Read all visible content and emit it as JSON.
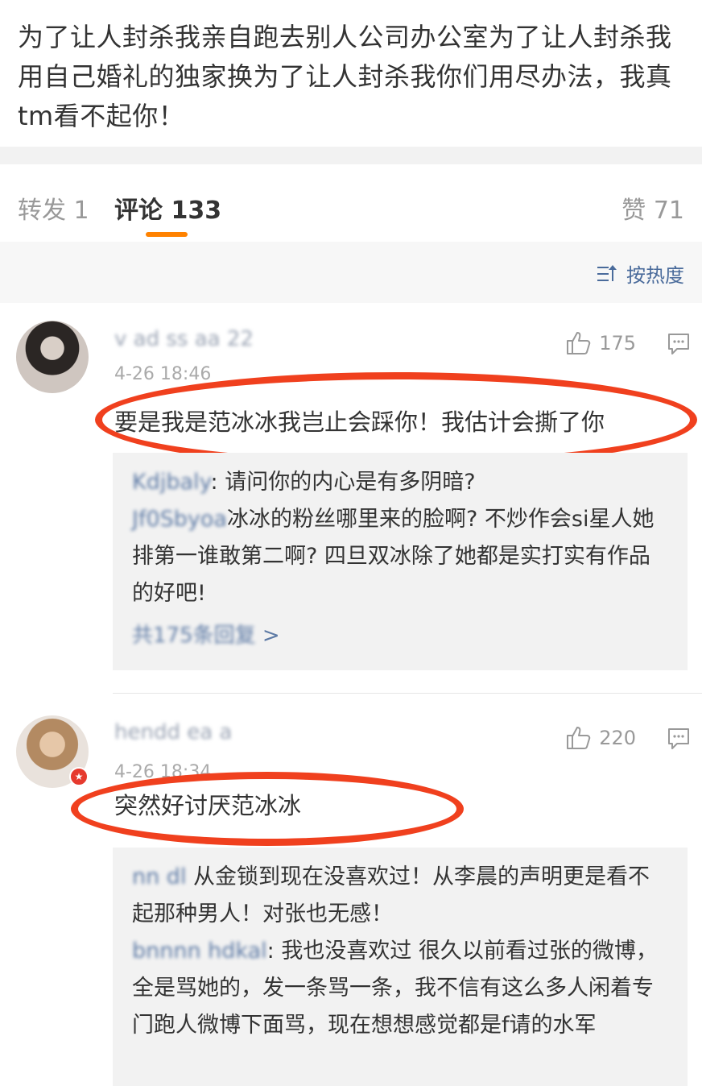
{
  "post": {
    "text": "为了让人封杀我亲自跑去别人公司办公室为了让人封杀我用自己婚礼的独家换为了让人封杀我你们用尽办法，我真tm看不起你！"
  },
  "tabs": {
    "repost": "转发 1",
    "comments": "评论 133",
    "likes": "赞 71"
  },
  "sort": {
    "label": "按热度"
  },
  "comments": [
    {
      "username": "v ad ss aa 22",
      "time": "4-26 18:46",
      "likes": "175",
      "text": "要是我是范冰冰我岂止会踩你！我估计会撕了你",
      "replies": [
        {
          "user": "Kdjbaly",
          "text": ": 请问你的内心是有多阴暗?"
        },
        {
          "user": "Jf0Sbyoa",
          "text": "冰冰的粉丝哪里来的脸啊? 不炒作会si星人她排第一谁敢第二啊? 四旦双冰除了她都是实打实有作品的好吧!"
        }
      ],
      "more": "共175条回复",
      "more_arrow": ">"
    },
    {
      "username": "hendd ea a",
      "time": "4-26 18:34",
      "likes": "220",
      "text": "突然好讨厌范冰冰",
      "replies": [
        {
          "user": "nn dl",
          "text": "从金锁到现在没喜欢过！从李晨的声明更是看不起那种男人！对张也无感！"
        },
        {
          "user": "bnnnn hdkal",
          "text": ": 我也没喜欢过 很久以前看过张的微博，全是骂她的，发一条骂一条，我不信有这么多人闲着专门跑人微博下面骂，现在想想感觉都是f请的水军"
        }
      ]
    }
  ],
  "colors": {
    "accent": "#ff8200",
    "link": "#5d7aa5",
    "highlight": "#f0401e"
  }
}
